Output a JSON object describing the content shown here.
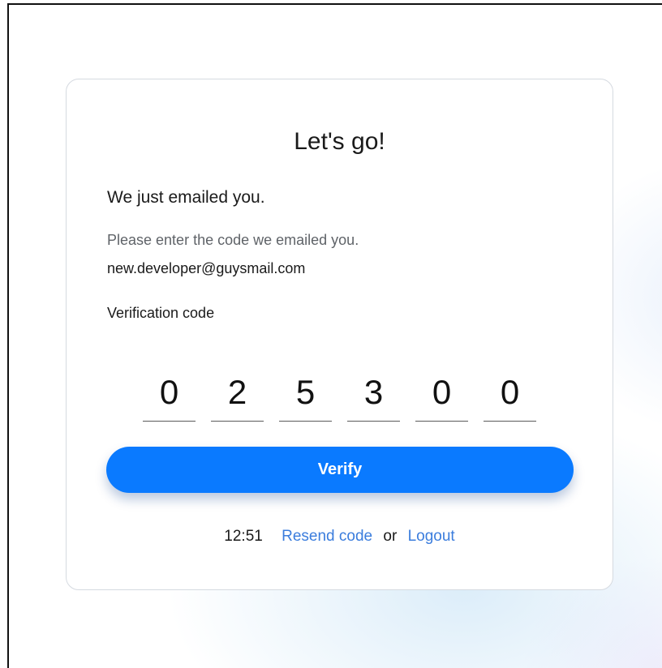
{
  "card": {
    "title": "Let's go!",
    "subtitle": "We just emailed you.",
    "instruction": "Please enter the code we emailed you.",
    "email": "new.developer@guysmail.com",
    "code_label": "Verification code",
    "code_digits": [
      "0",
      "2",
      "5",
      "3",
      "0",
      "0"
    ],
    "verify_label": "Verify",
    "footer": {
      "timer": "12:51",
      "resend_label": "Resend code",
      "or_text": "or",
      "logout_label": "Logout"
    }
  },
  "colors": {
    "primary": "#0a7aff",
    "link": "#3b7ddd",
    "muted_text": "#5f6368"
  }
}
